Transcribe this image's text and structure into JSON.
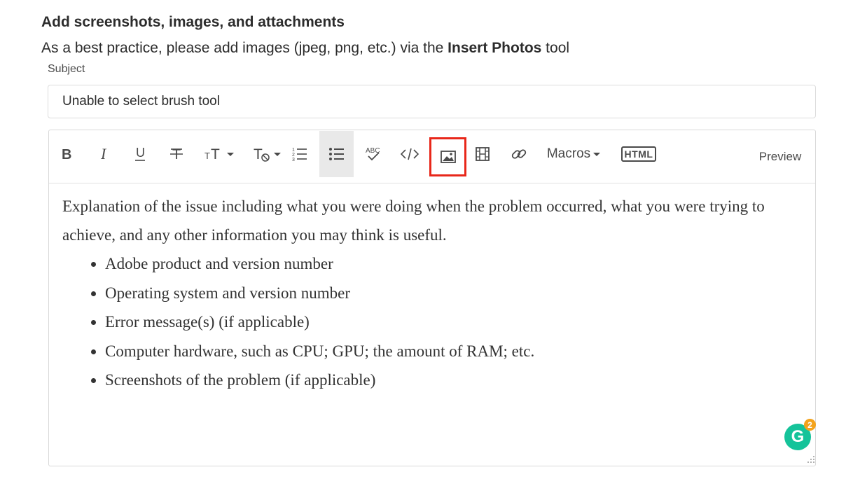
{
  "heading": "Add screenshots, images, and attachments",
  "intro": {
    "before": "As a best practice, please add images (jpeg, png, etc.) via the ",
    "bold": "Insert Photos",
    "after": " tool"
  },
  "subject": {
    "label": "Subject",
    "value": "Unable to select brush tool"
  },
  "toolbar": {
    "items": [
      {
        "name": "bold",
        "icon": "bold-icon"
      },
      {
        "name": "italic",
        "icon": "italic-icon"
      },
      {
        "name": "underline",
        "icon": "underline-icon"
      },
      {
        "name": "strikethrough",
        "icon": "strikethrough-icon"
      },
      {
        "name": "font-size",
        "icon": "font-size-icon"
      },
      {
        "name": "clear-format",
        "icon": "clear-format-icon"
      },
      {
        "name": "numbered-list",
        "icon": "numbered-list-icon"
      },
      {
        "name": "bulleted-list",
        "icon": "bulleted-list-icon",
        "active": true
      },
      {
        "name": "spellcheck",
        "icon": "spellcheck-icon"
      },
      {
        "name": "code",
        "icon": "code-icon"
      },
      {
        "name": "insert-photos",
        "icon": "image-icon",
        "highlighted": true
      },
      {
        "name": "insert-video",
        "icon": "film-icon"
      },
      {
        "name": "insert-link",
        "icon": "link-icon"
      }
    ],
    "macros_label": "Macros",
    "html_label": "HTML",
    "preview_label": "Preview",
    "highlight_color": "#e8271a"
  },
  "body": {
    "paragraph": "Explanation of the issue including what you were doing when the problem occurred, what you were trying to achieve, and any other information you may think is useful.",
    "bullets": [
      "Adobe product and version number",
      "Operating system and version number",
      "Error message(s) (if applicable)",
      "Computer hardware, such as CPU; GPU; the amount of RAM; etc.",
      "Screenshots of the problem (if applicable)"
    ]
  },
  "grammarly": {
    "letter": "G",
    "badge_count": "2",
    "color": "#15c39a",
    "badge_color": "#f4a31c"
  }
}
